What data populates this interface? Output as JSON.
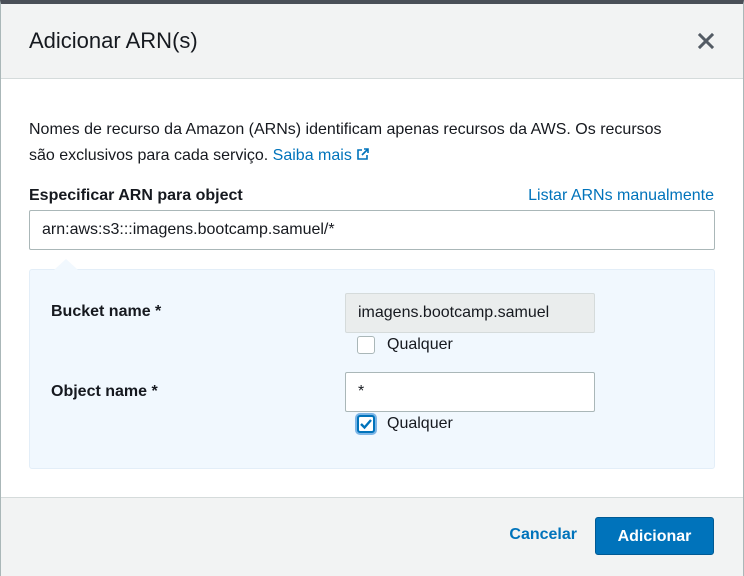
{
  "modal": {
    "title": "Adicionar ARN(s)",
    "close_icon": "close-icon"
  },
  "description": {
    "text": "Nomes de recurso da Amazon (ARNs) identificam apenas recursos da AWS. Os recursos são exclusivos para cada serviço.",
    "link_label": "Saiba mais",
    "link_icon": "external-link-icon"
  },
  "arn_field": {
    "label": "Especificar ARN para object",
    "manual_link": "Listar ARNs manualmente",
    "value": "arn:aws:s3:::imagens.bootcamp.samuel/*"
  },
  "bucket": {
    "label": "Bucket name *",
    "value": "imagens.bootcamp.samuel",
    "disabled": true,
    "any_label": "Qualquer",
    "any_checked": false
  },
  "object": {
    "label": "Object name *",
    "value": "*",
    "disabled": false,
    "any_label": "Qualquer",
    "any_checked": true
  },
  "footer": {
    "cancel_label": "Cancelar",
    "submit_label": "Adicionar"
  },
  "colors": {
    "link": "#0073bb",
    "primary": "#0073bb",
    "panel_bg": "#f1f8fe",
    "header_bg": "#f2f3f3"
  }
}
